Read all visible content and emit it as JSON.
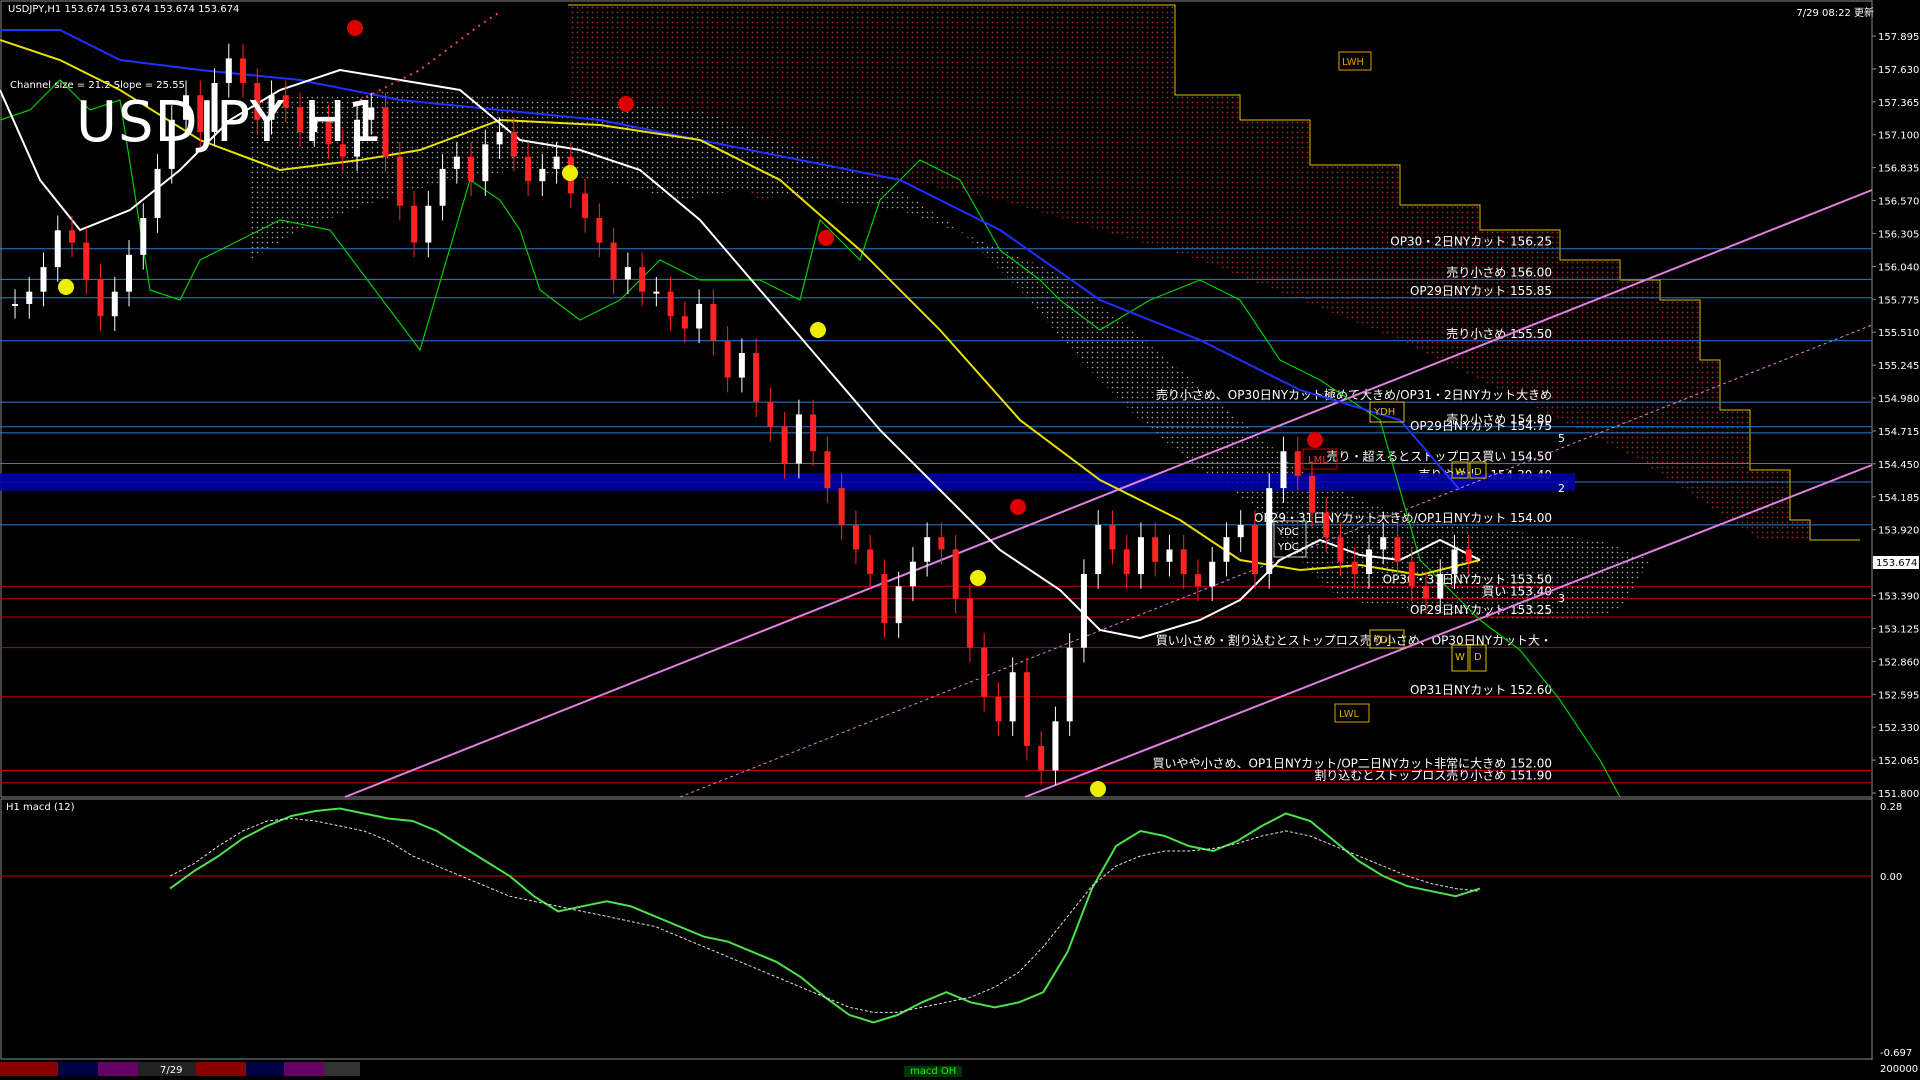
{
  "header": {
    "symbol_line": "USDJPY,H1  153.674 153.674 153.674 153.674",
    "timestamp": "7/29 08:22 更新",
    "title": "USDJPY H1",
    "channel_info": "Channel size = 21.2  Slope = 25.55",
    "macd_label": "H1  macd (12)",
    "bottom_tab": "macd OH",
    "date_tab": "7/29"
  },
  "price_axis": {
    "labels": [
      "157.895",
      "157.630",
      "157.365",
      "157.100",
      "156.835",
      "156.570",
      "156.305",
      "156.040",
      "155.775",
      "155.510",
      "155.245",
      "154.980",
      "154.715",
      "154.450",
      "154.185",
      "153.920",
      "153.655",
      "153.390",
      "153.125",
      "152.860",
      "152.595",
      "152.330",
      "152.065",
      "151.800"
    ],
    "current": "153.674",
    "ymin": 151.8,
    "ymax": 157.95
  },
  "macd_axis": {
    "labels": [
      "0.28",
      "0.00",
      "-0.697"
    ],
    "bottom_label": "200000"
  },
  "levels": [
    {
      "price": 156.25,
      "text": "OP30・2日NYカット 156.25"
    },
    {
      "price": 156.0,
      "text": "売り小さめ 156.00"
    },
    {
      "price": 155.85,
      "text": "OP29日NYカット 155.85"
    },
    {
      "price": 155.5,
      "text": "売り小さめ 155.50"
    },
    {
      "price": 155.0,
      "text": "売り小さめ、OP30日NYカット極めて大きめ/OP31・2日NYカット大きめ"
    },
    {
      "price": 154.8,
      "text": "売り小さめ 154.80"
    },
    {
      "price": 154.75,
      "text": "OP29日NYカット 154.75"
    },
    {
      "price": 154.5,
      "text": "売り・超えるとストップロス買い 154.50"
    },
    {
      "price": 154.35,
      "text": "売りやや小　154.30-40"
    },
    {
      "price": 154.0,
      "text": "OP29・31日NYカット大きめ/OP1日NYカット 154.00"
    },
    {
      "price": 153.5,
      "text": "OP30・31日NYカット 153.50"
    },
    {
      "price": 153.4,
      "text": "買い 153.40"
    },
    {
      "price": 153.25,
      "text": "OP29日NYカット 153.25"
    },
    {
      "price": 153.0,
      "text": "買い小さめ・割り込むとストップロス売り小さめ、OP30日NYカット大・"
    },
    {
      "price": 152.6,
      "text": "OP31日NYカット 152.60"
    },
    {
      "price": 152.0,
      "text": "買いやや小さめ、OP1日NYカット/OP二日NYカット非常に大きめ 152.00"
    },
    {
      "price": 151.9,
      "text": "割り込むとストップロス売り小さめ 151.90"
    }
  ],
  "markers": {
    "lwh": "LWH",
    "ydh": "YDH",
    "lml": "LML",
    "ydc1": "YDC",
    "ydc2": "YDC",
    "ydl": "YDL",
    "lwl": "LWL",
    "w": "W",
    "d": "D",
    "num5": "5",
    "num2": "2",
    "num3": "3"
  },
  "chart_data": {
    "type": "line",
    "title": "USDJPY H1",
    "price_close": [
      155.8,
      155.9,
      156.1,
      156.4,
      156.3,
      156.0,
      155.7,
      155.9,
      156.2,
      156.5,
      156.9,
      157.3,
      157.5,
      157.2,
      157.6,
      157.8,
      157.6,
      157.3,
      157.5,
      157.4,
      157.2,
      157.3,
      157.1,
      157.0,
      157.3,
      157.4,
      157.0,
      156.6,
      156.3,
      156.6,
      156.9,
      157.0,
      156.8,
      157.1,
      157.2,
      157.0,
      156.8,
      156.9,
      157.0,
      156.7,
      156.5,
      156.3,
      156.0,
      156.1,
      155.9,
      155.9,
      155.7,
      155.6,
      155.8,
      155.5,
      155.2,
      155.4,
      155.0,
      154.8,
      154.5,
      154.9,
      154.6,
      154.3,
      154.0,
      153.8,
      153.6,
      153.2,
      153.5,
      153.7,
      153.9,
      153.8,
      153.4,
      153.0,
      152.6,
      152.4,
      152.8,
      152.2,
      152.0,
      152.4,
      153.0,
      153.6,
      154.0,
      153.8,
      153.6,
      153.9,
      153.7,
      153.8,
      153.6,
      153.5,
      153.7,
      153.9,
      154.0,
      153.6,
      154.3,
      154.6,
      154.4,
      154.1,
      153.9,
      153.7,
      153.6,
      153.8,
      153.9,
      153.7,
      153.5,
      153.4,
      153.6,
      153.8,
      153.7
    ],
    "macd": [
      -0.05,
      0.02,
      0.08,
      0.15,
      0.2,
      0.24,
      0.26,
      0.27,
      0.25,
      0.23,
      0.22,
      0.18,
      0.12,
      0.06,
      0.0,
      -0.08,
      -0.14,
      -0.12,
      -0.1,
      -0.12,
      -0.16,
      -0.2,
      -0.24,
      -0.26,
      -0.3,
      -0.34,
      -0.4,
      -0.48,
      -0.55,
      -0.58,
      -0.55,
      -0.5,
      -0.46,
      -0.5,
      -0.52,
      -0.5,
      -0.46,
      -0.3,
      -0.05,
      0.12,
      0.18,
      0.16,
      0.12,
      0.1,
      0.14,
      0.2,
      0.25,
      0.22,
      0.14,
      0.06,
      0.0,
      -0.04,
      -0.06,
      -0.08,
      -0.05
    ],
    "macd_signal": [
      0.0,
      0.05,
      0.12,
      0.18,
      0.22,
      0.23,
      0.22,
      0.2,
      0.18,
      0.14,
      0.08,
      0.04,
      0.0,
      -0.04,
      -0.08,
      -0.1,
      -0.12,
      -0.14,
      -0.16,
      -0.18,
      -0.2,
      -0.24,
      -0.28,
      -0.32,
      -0.36,
      -0.4,
      -0.44,
      -0.48,
      -0.52,
      -0.54,
      -0.54,
      -0.52,
      -0.5,
      -0.48,
      -0.44,
      -0.38,
      -0.28,
      -0.16,
      -0.04,
      0.04,
      0.08,
      0.1,
      0.1,
      0.11,
      0.13,
      0.16,
      0.18,
      0.16,
      0.12,
      0.08,
      0.04,
      0.0,
      -0.03,
      -0.05,
      -0.06
    ],
    "ylim": [
      151.8,
      157.95
    ]
  }
}
